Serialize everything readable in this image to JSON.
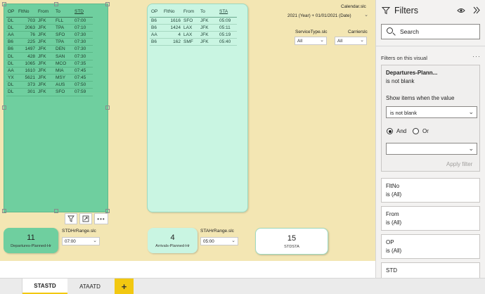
{
  "departures_table": {
    "columns": [
      "OP",
      "FltNo",
      "From",
      "To",
      "STD"
    ],
    "rows": [
      [
        "DL",
        "703",
        "JFK",
        "FLL",
        "07:00"
      ],
      [
        "DL",
        "2063",
        "JFK",
        "TPA",
        "07:10"
      ],
      [
        "AA",
        "76",
        "JFK",
        "SFO",
        "07:30"
      ],
      [
        "B6",
        "225",
        "JFK",
        "TPA",
        "07:30"
      ],
      [
        "B6",
        "1497",
        "JFK",
        "DEN",
        "07:30"
      ],
      [
        "DL",
        "428",
        "JFK",
        "SAN",
        "07:30"
      ],
      [
        "DL",
        "1065",
        "JFK",
        "MCO",
        "07:35"
      ],
      [
        "AA",
        "1610",
        "JFK",
        "MIA",
        "07:45"
      ],
      [
        "YX",
        "5621",
        "JFK",
        "MSY",
        "07:45"
      ],
      [
        "DL",
        "373",
        "JFK",
        "AUS",
        "07:50"
      ],
      [
        "DL",
        "301",
        "JFK",
        "SFO",
        "07:59"
      ]
    ]
  },
  "arrivals_table": {
    "columns": [
      "OP",
      "FltNo",
      "From",
      "To",
      "STA"
    ],
    "rows": [
      [
        "B6",
        "1616",
        "SFO",
        "JFK",
        "05:09"
      ],
      [
        "B6",
        "1424",
        "LAX",
        "JFK",
        "05:11"
      ],
      [
        "AA",
        "4",
        "LAX",
        "JFK",
        "05:19"
      ],
      [
        "B6",
        "162",
        "SMF",
        "JFK",
        "05:40"
      ]
    ]
  },
  "slicers": {
    "calendar": {
      "label": "Calendar.slc",
      "value": "2021 (Year) + 01/01/2021 (Date)"
    },
    "service_type": {
      "label": "ServiceType.slc",
      "value": "All"
    },
    "carrier": {
      "label": "Carrierslc",
      "value": "All"
    },
    "std_hr_range": {
      "label": "STDHrRange.slc",
      "value": "07:00"
    },
    "sta_hr_range": {
      "label": "STAHrRange.slc",
      "value": "05:00"
    }
  },
  "cards": {
    "departures": {
      "value": "11",
      "label": "Departures-Planned-Hr"
    },
    "arrivals": {
      "value": "4",
      "label": "Arrivals-Planned-Hr"
    },
    "stdsta": {
      "value": "15",
      "label": "STDSTA"
    }
  },
  "tabs": [
    {
      "label": "STASTD",
      "active": true
    },
    {
      "label": "ATAATD",
      "active": false
    }
  ],
  "tab_add_label": "+",
  "filters_pane": {
    "title": "Filters",
    "search_placeholder": "Search",
    "section_label": "Filters on this visual",
    "expanded_filter": {
      "title": "Departures-Plann...",
      "subtitle": "is not blank",
      "show_items_label": "Show items when the value",
      "condition_value": "is not blank",
      "and_label": "And",
      "or_label": "Or",
      "second_value": "",
      "apply_label": "Apply filter"
    },
    "filters": [
      {
        "name": "FltNo",
        "state": "is (All)"
      },
      {
        "name": "From",
        "state": "is (All)"
      },
      {
        "name": "OP",
        "state": "is (All)"
      },
      {
        "name": "STD",
        "state": ""
      }
    ]
  },
  "colors": {
    "canvas": "#f3e6b3",
    "departures_fill": "#6fcf9f",
    "arrivals_fill": "#c9f5e2",
    "tab_accent": "#f2c811"
  }
}
